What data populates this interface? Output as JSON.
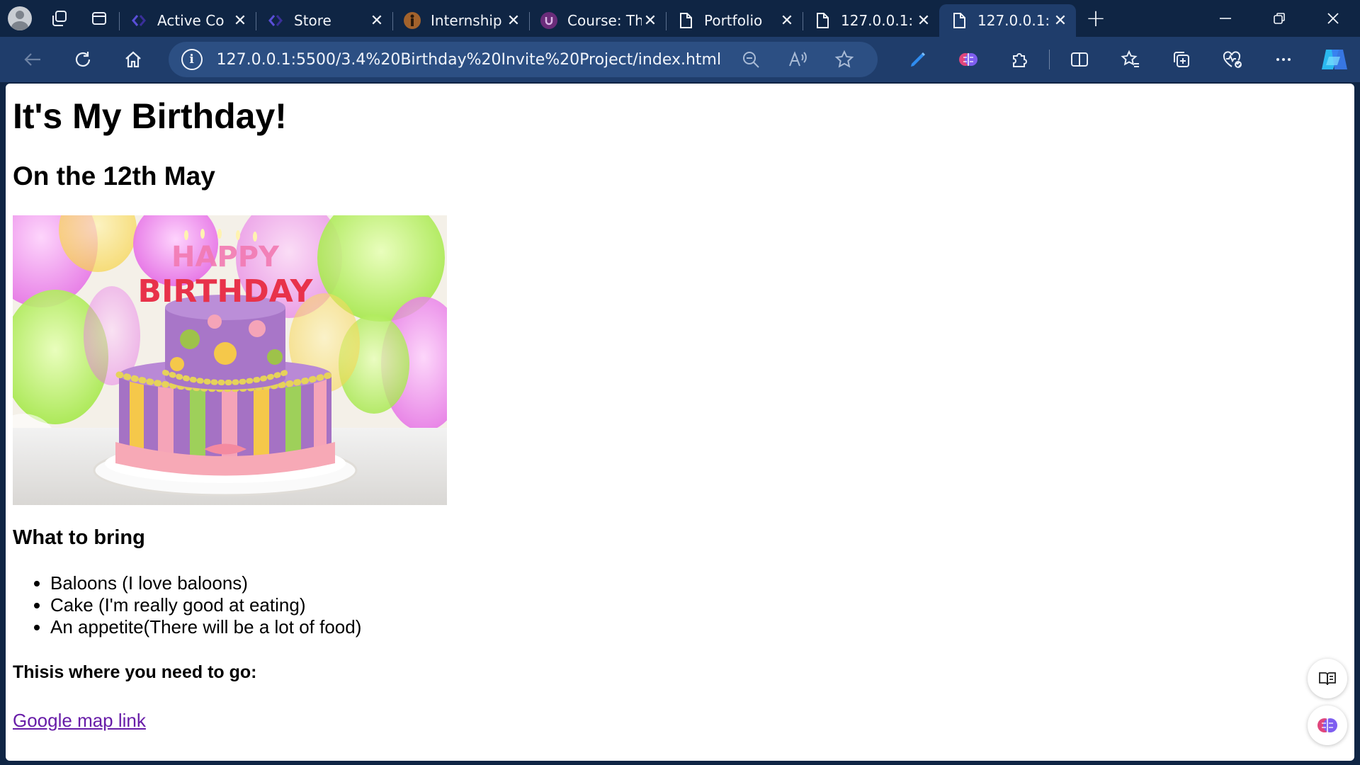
{
  "browser": {
    "tabs": [
      {
        "title": "Active Co",
        "icon": "code-icon"
      },
      {
        "title": "Store",
        "icon": "code-icon"
      },
      {
        "title": "Internship",
        "icon": "person-icon"
      },
      {
        "title": "Course: Th",
        "icon": "course-icon"
      },
      {
        "title": "Portfolio",
        "icon": "page-icon"
      },
      {
        "title": "127.0.0.1:",
        "icon": "page-icon"
      },
      {
        "title": "127.0.0.1:",
        "icon": "page-icon",
        "active": true
      }
    ],
    "address": "127.0.0.1:5500/3.4%20Birthday%20Invite%20Project/index.html"
  },
  "page": {
    "heading": "It's My Birthday!",
    "date_heading": "On the 12th May",
    "image_text_line1": "HAPPY",
    "image_text_line2": "BIRTHDAY",
    "bring_heading": "What to bring",
    "bring_items": [
      "Baloons (I love baloons)",
      "Cake (I'm really good at eating)",
      "An appetite(There will be a lot of food)"
    ],
    "where_heading": "Thisis where you need to go:",
    "map_link": "Google map link"
  },
  "colors": {
    "titlebar": "#0f2544",
    "toolbar": "#1f3d6b",
    "address_bar": "#2c4f83",
    "visited_link": "#681da8"
  }
}
